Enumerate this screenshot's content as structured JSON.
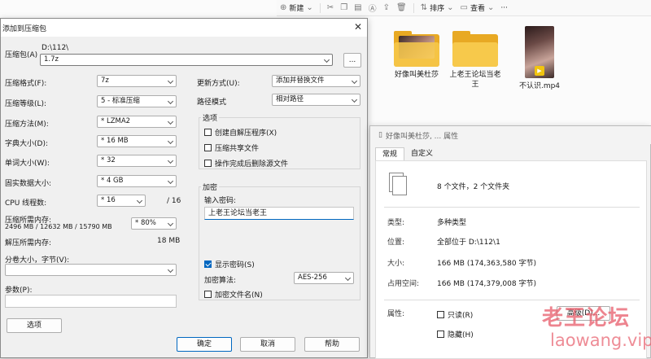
{
  "explorer": {
    "toolbar": {
      "new_label": "新建",
      "sort_label": "排序",
      "view_label": "查看",
      "more_label": "···"
    },
    "files": [
      {
        "name": "好像叫美杜莎",
        "type": "folder"
      },
      {
        "name": "上老王论坛当老王",
        "type": "folder"
      },
      {
        "name": "不认识.mp4",
        "type": "video"
      }
    ]
  },
  "archive_dialog": {
    "title": "添加到压缩包",
    "archive_label": "压缩包(A)",
    "archive_path": "D:\\112\\",
    "archive_name": "1.7z",
    "browse_label": "...",
    "format_label": "压缩格式(F):",
    "format_value": "7z",
    "level_label": "压缩等级(L):",
    "level_value": "5 - 标准压缩",
    "method_label": "压缩方法(M):",
    "method_value": "* LZMA2",
    "dict_label": "字典大小(D):",
    "dict_value": "* 16 MB",
    "word_label": "单词大小(W):",
    "word_value": "* 32",
    "solid_label": "固实数据大小:",
    "solid_value": "* 4 GB",
    "cpu_label": "CPU 线程数:",
    "cpu_value": "* 16",
    "cpu_total": "/ 16",
    "mem_label": "压缩所需内存:",
    "mem_detail": "2496 MB / 12632 MB / 15790 MB",
    "mem_value": "* 80%",
    "decomp_label": "解压所需内存:",
    "decomp_value": "18 MB",
    "split_label": "分卷大小，字节(V):",
    "params_label": "参数(P):",
    "options_button": "选项",
    "update_label": "更新方式(U):",
    "update_value": "添加并替换文件",
    "pathmode_label": "路径模式",
    "pathmode_value": "相对路径",
    "options_group": "选项",
    "opt_sfx": "创建自解压程序(X)",
    "opt_shared": "压缩共享文件",
    "opt_delete": "操作完成后删除源文件",
    "encrypt_group": "加密",
    "password_label": "输入密码:",
    "password_value": "上老王论坛当老王",
    "show_password": "显示密码(S)",
    "enc_method_label": "加密算法:",
    "enc_method_value": "AES-256",
    "encrypt_names": "加密文件名(N)",
    "ok": "确定",
    "cancel": "取消",
    "help": "帮助"
  },
  "properties_dialog": {
    "title": "好像叫美杜莎, ... 属性",
    "tab_general": "常规",
    "tab_custom": "自定义",
    "summary": "8 个文件，2 个文件夹",
    "type_key": "类型:",
    "type_value": "多种类型",
    "location_key": "位置:",
    "location_value": "全部位于 D:\\112\\1",
    "size_key": "大小:",
    "size_value": "166 MB (174,363,580 字节)",
    "disk_key": "占用空间:",
    "disk_value": "166 MB (174,379,008 字节)",
    "attr_key": "属性:",
    "readonly": "只读(R)",
    "hidden": "隐藏(H)",
    "advanced": "高级(D)..."
  },
  "watermark": {
    "line1": "老王论坛",
    "line2": "laowang.vip"
  }
}
